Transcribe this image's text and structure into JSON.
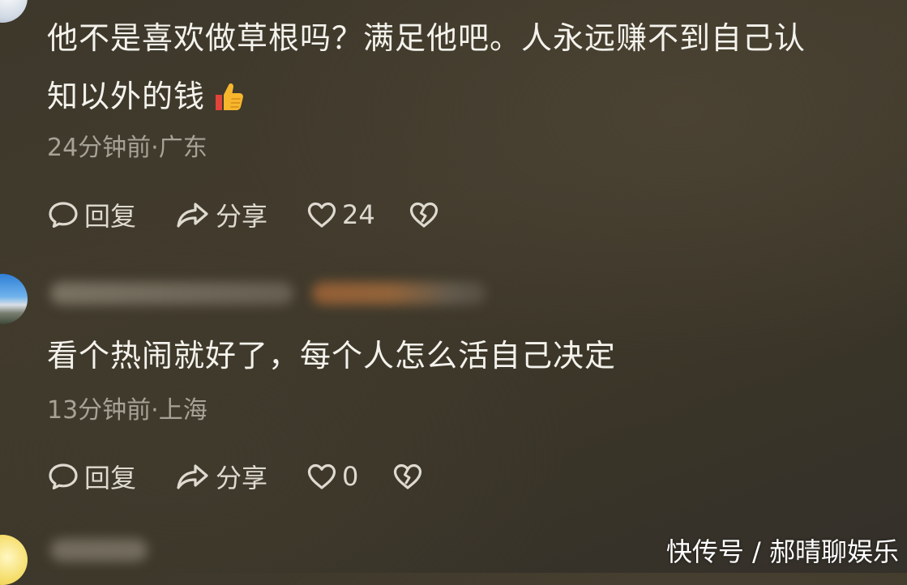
{
  "comments": [
    {
      "text_line1": "他不是喜欢做草根吗？满足他吧。人永远赚不到自己认",
      "text_line2": "知以外的钱",
      "emoji": "thumbs-up",
      "meta": "24分钟前·广东",
      "reply_label": "回复",
      "share_label": "分享",
      "like_count": "24"
    },
    {
      "text_line1": "看个热闹就好了，每个人怎么活自己决定",
      "meta": "13分钟前·上海",
      "reply_label": "回复",
      "share_label": "分享",
      "like_count": "0"
    }
  ],
  "icons": {
    "reply": "reply-bubble-icon",
    "share": "share-arrow-icon",
    "like": "heart-icon",
    "dislike": "broken-heart-icon",
    "emoji": "thumbs-up-icon"
  },
  "colors": {
    "background": "#3d382b",
    "primary_text": "#f4f2ec",
    "secondary_text": "#a7a296",
    "action_text": "#dedad0"
  },
  "watermark": "快传号 / 郝晴聊娱乐"
}
